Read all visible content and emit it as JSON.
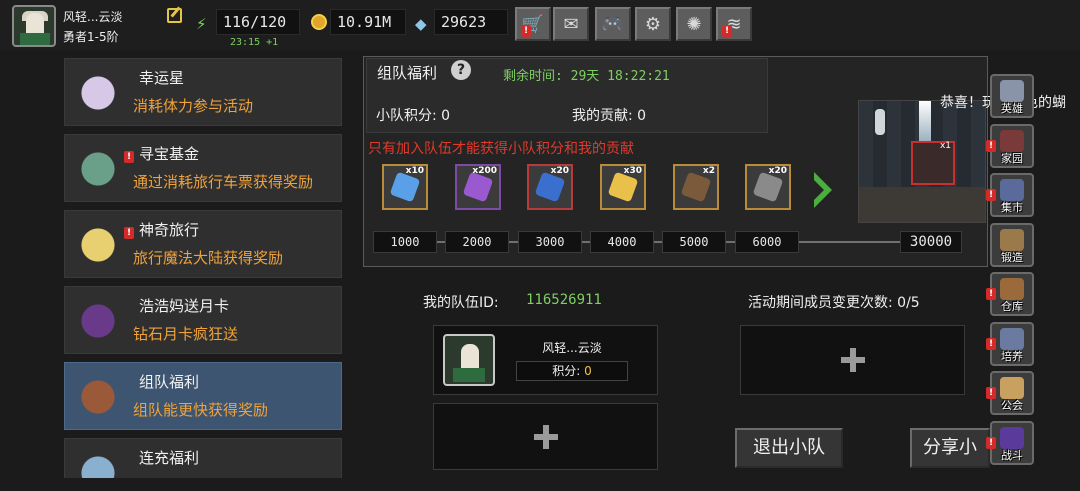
{
  "player": {
    "name": "风轻...云淡",
    "rank": "勇者1-5阶"
  },
  "resources": {
    "energy": "116/120",
    "energy_timer": "23:15 +1",
    "coins": "10.91M",
    "gems": "29623"
  },
  "top_buttons": [
    {
      "icon": "shopping-cart-icon",
      "glyph": "🛒",
      "alert": true
    },
    {
      "icon": "mail-icon",
      "glyph": "✉",
      "alert": false
    },
    {
      "icon": "gamepad-icon",
      "glyph": "🎮",
      "alert": false
    },
    {
      "icon": "settings-gear-icon",
      "glyph": "⚙",
      "alert": false
    },
    {
      "icon": "color-wheel-icon",
      "glyph": "✺",
      "alert": false
    },
    {
      "icon": "signal-icon",
      "glyph": "≋",
      "alert": true
    }
  ],
  "events": [
    {
      "title": "幸运星",
      "desc": "消耗体力参与活动",
      "alert": false,
      "active": false,
      "icon": "lucky-star-icon"
    },
    {
      "title": "寻宝基金",
      "desc": "通过消耗旅行车票获得奖励",
      "alert": true,
      "active": false,
      "icon": "treasure-bag-icon"
    },
    {
      "title": "神奇旅行",
      "desc": "旅行魔法大陆获得奖励",
      "alert": true,
      "active": false,
      "icon": "ticket-icon"
    },
    {
      "title": "浩浩妈送月卡",
      "desc": "钻石月卡疯狂送",
      "alert": false,
      "active": false,
      "icon": "month-card-icon"
    },
    {
      "title": "组队福利",
      "desc": "组队能更快获得奖励",
      "alert": false,
      "active": true,
      "icon": "team-chest-icon"
    },
    {
      "title": "连充福利",
      "desc": "",
      "alert": false,
      "active": false,
      "icon": "crystal-icon"
    }
  ],
  "panel": {
    "title": "组队福利",
    "remaining_time": "剩余时间: 29天 18:22:21",
    "team_score_label": "小队积分: 0",
    "contribution_label": "我的贡献: 0",
    "warning": "只有加入队伍才能获得小队积分和我的贡献"
  },
  "rewards": [
    {
      "qty": "x10",
      "icon": "lightning-icon",
      "color": "#5aa0e8",
      "border": "#b98c3a"
    },
    {
      "qty": "x200",
      "icon": "purple-crystal-icon",
      "color": "#9b59d0",
      "border": "#7d4aa8"
    },
    {
      "qty": "x20",
      "icon": "blue-scroll-icon",
      "color": "#3a6fd0",
      "border": "#b83a3a"
    },
    {
      "qty": "x30",
      "icon": "golden-egg-icon",
      "color": "#e8c04a",
      "border": "#b98c3a"
    },
    {
      "qty": "x2",
      "icon": "scroll-icon",
      "color": "#7a5a3a",
      "border": "#b98c3a"
    },
    {
      "qty": "x20",
      "icon": "hammer-icon",
      "color": "#8a8a8a",
      "border": "#b98c3a"
    }
  ],
  "milestones": [
    "1000",
    "2000",
    "3000",
    "4000",
    "5000",
    "6000",
    "30000"
  ],
  "preview": {
    "qty": "x1",
    "congrats": "恭喜！玩家粉色的蝴"
  },
  "team": {
    "id_label": "我的队伍ID:",
    "id_value": "116526911",
    "changes_label": "活动期间成员变更次数: 0/5",
    "member_name": "风轻...云淡",
    "member_score_label": "积分:",
    "member_score_value": "0"
  },
  "buttons": {
    "leave": "退出小队",
    "share": "分享小"
  },
  "side_menu": [
    {
      "label": "英雄",
      "icon": "hero-icon",
      "alert": false
    },
    {
      "label": "家园",
      "icon": "home-icon",
      "alert": true
    },
    {
      "label": "集市",
      "icon": "market-icon",
      "alert": true
    },
    {
      "label": "锻造",
      "icon": "anvil-icon",
      "alert": false
    },
    {
      "label": "仓库",
      "icon": "warehouse-icon",
      "alert": true
    },
    {
      "label": "培养",
      "icon": "cultivate-icon",
      "alert": true
    },
    {
      "label": "公会",
      "icon": "guild-icon",
      "alert": true
    },
    {
      "label": "战斗",
      "icon": "battle-portal-icon",
      "alert": true
    }
  ]
}
